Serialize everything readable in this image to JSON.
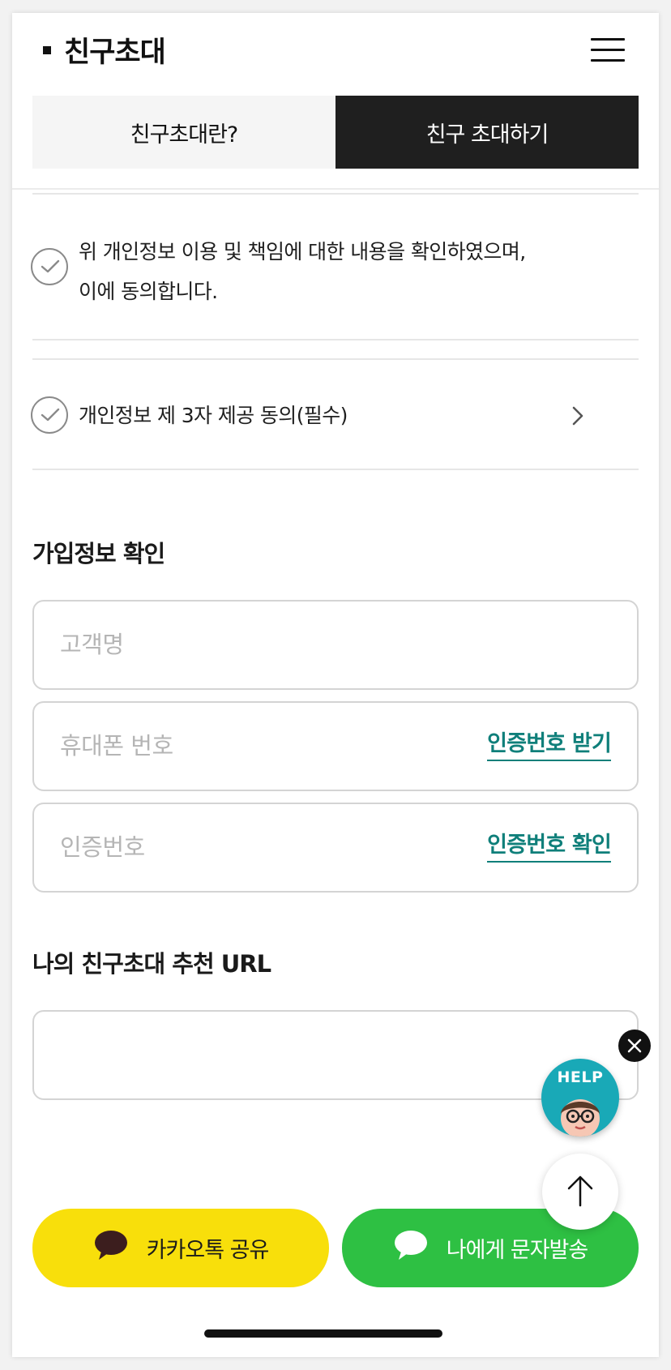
{
  "header": {
    "title": "친구초대",
    "tabs": [
      {
        "label": "친구초대란?",
        "active": false
      },
      {
        "label": "친구 초대하기",
        "active": true
      }
    ]
  },
  "agreements": [
    {
      "line1": "위 개인정보 이용 및 책임에 대한 내용을 확인하였으며,",
      "line2": "이에 동의합니다.",
      "checked": false
    },
    {
      "line1": "개인정보 제 3자 제공 동의(필수)",
      "checked": false
    }
  ],
  "signup_section": {
    "title": "가입정보 확인",
    "name_placeholder": "고객명",
    "phone_placeholder": "휴대폰 번호",
    "request_code_label": "인증번호 받기",
    "code_placeholder": "인증번호",
    "verify_code_label": "인증번호 확인"
  },
  "url_section": {
    "title": "나의 친구초대 추천 URL",
    "value": ""
  },
  "buttons": {
    "kakao_label": "카카오톡 공유",
    "sms_label": "나에게 문자발송"
  },
  "floating": {
    "help_label": "HELP"
  },
  "colors": {
    "active_tab": "#1f1f1f",
    "link": "#0f7f7a",
    "kakao": "#f8df0b",
    "sms": "#2ec043",
    "help": "#19a9b7"
  }
}
